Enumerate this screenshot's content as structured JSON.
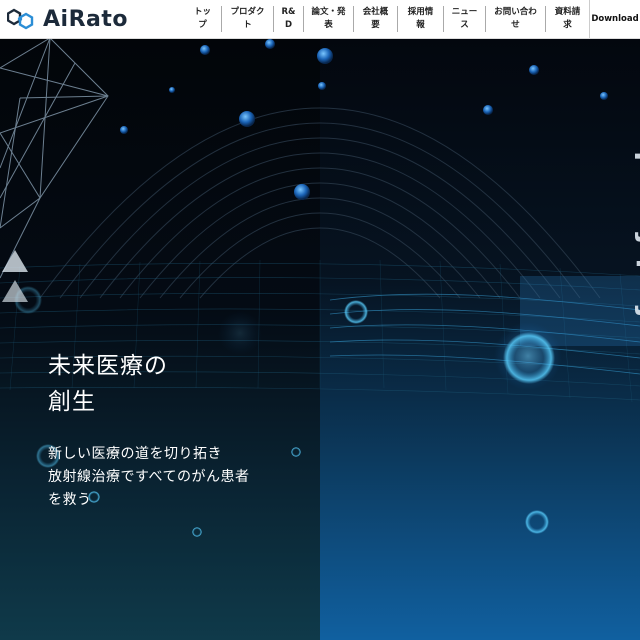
{
  "brand": {
    "name": "AiRato",
    "colors": {
      "logo_blue": "#2b8ed6",
      "logo_dark": "#1c2a3a"
    }
  },
  "nav": {
    "items": [
      {
        "label": "トッ\nプ"
      },
      {
        "label": "プロダク\nト"
      },
      {
        "label": "R&\nD"
      },
      {
        "label": "論文・発\n表"
      },
      {
        "label": "会社概\n要"
      },
      {
        "label": "採用情\n報"
      },
      {
        "label": "ニュー\nス"
      },
      {
        "label": "お問い合わ\nせ"
      },
      {
        "label": "資料請\n求"
      }
    ],
    "download_label": "Download"
  },
  "hero": {
    "headline": [
      "未来医療の",
      "創生"
    ],
    "subcopy": [
      "新しい医療の道を切り拓き",
      "放射線治療ですべてのがん患者",
      "を救う"
    ],
    "vertical_text": "fast founder"
  }
}
